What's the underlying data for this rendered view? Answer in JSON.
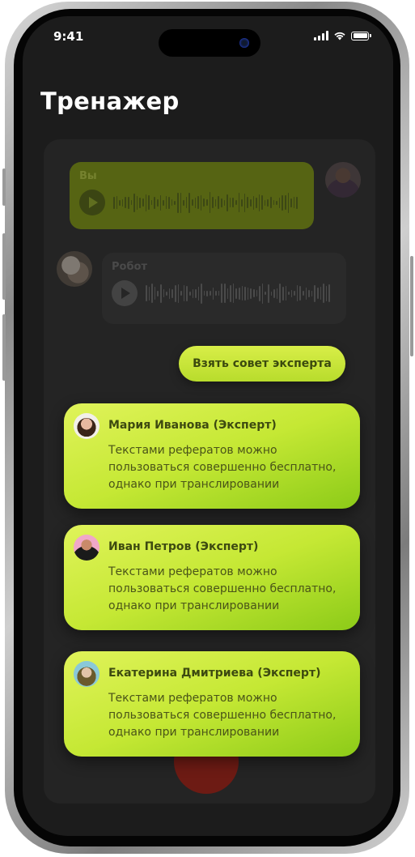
{
  "status_bar": {
    "time": "9:41"
  },
  "header": {
    "title": "Тренажер"
  },
  "chat": {
    "user_label": "Вы",
    "robot_label": "Робот"
  },
  "expert_button": {
    "label": "Взять совет эксперта"
  },
  "experts": [
    {
      "name": "Мария Иванова (Эксперт)",
      "text": "Текстами рефератов можно пользоваться совершенно бесплатно, однако при транслировании"
    },
    {
      "name": "Иван Петров (Эксперт)",
      "text": "Текстами рефератов можно пользоваться совершенно бесплатно, однако при транслировании"
    },
    {
      "name": "Екатерина Дмитриева (Эксперт)",
      "text": "Текстами рефератов можно пользоваться совершенно бесплатно, однако при транслировании"
    }
  ],
  "colors": {
    "accent": "#c5e834",
    "background": "#1c1c1c",
    "record": "#7a1a12"
  },
  "icons": [
    "play-icon",
    "signal-icon",
    "wifi-icon",
    "battery-icon"
  ]
}
